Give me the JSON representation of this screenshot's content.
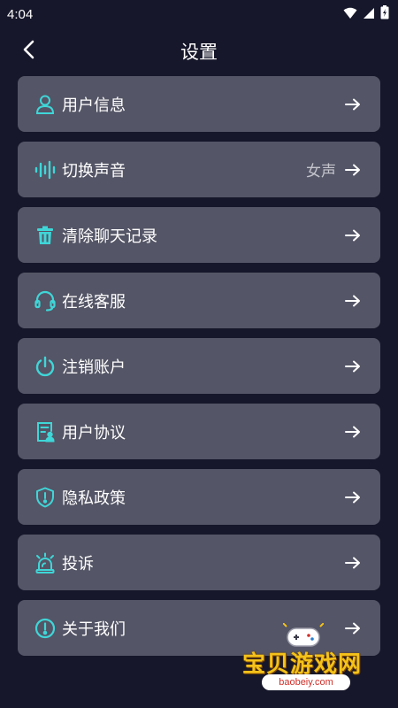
{
  "status_bar": {
    "time": "4:04"
  },
  "header": {
    "title": "设置"
  },
  "theme": {
    "background": "#16172a",
    "card": "#545566",
    "accent": "#3fd6d8"
  },
  "menu": [
    {
      "label": "用户信息",
      "icon": "user-icon"
    },
    {
      "label": "切换声音",
      "icon": "sound-wave-icon",
      "value": "女声"
    },
    {
      "label": "清除聊天记录",
      "icon": "trash-icon"
    },
    {
      "label": "在线客服",
      "icon": "headset-icon"
    },
    {
      "label": "注销账户",
      "icon": "power-icon"
    },
    {
      "label": "用户协议",
      "icon": "document-icon"
    },
    {
      "label": "隐私政策",
      "icon": "shield-icon"
    },
    {
      "label": "投诉",
      "icon": "alarm-icon"
    },
    {
      "label": "关于我们",
      "icon": "info-icon"
    }
  ],
  "watermark": {
    "title": "宝贝游戏网",
    "url": "baobeiy.com"
  }
}
